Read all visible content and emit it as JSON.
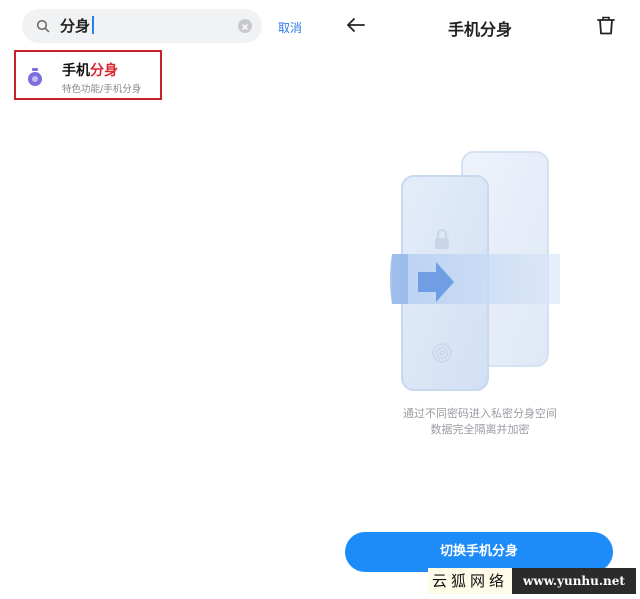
{
  "search": {
    "query": "分身",
    "cancel_label": "取消"
  },
  "result": {
    "title_plain": "手机",
    "title_highlight": "分身",
    "subtitle": "特色功能/手机分身"
  },
  "detail": {
    "title": "手机分身",
    "description_line1": "通过不同密码进入私密分身空间",
    "description_line2": "数据完全隔离并加密",
    "switch_button": "切换手机分身"
  },
  "watermark": {
    "left_text": "云狐网络",
    "right_text": "www.yunhu.net"
  },
  "colors": {
    "accent_blue": "#1d8cf8",
    "highlight_red": "#d8262f",
    "result_border": "#c8202a"
  }
}
